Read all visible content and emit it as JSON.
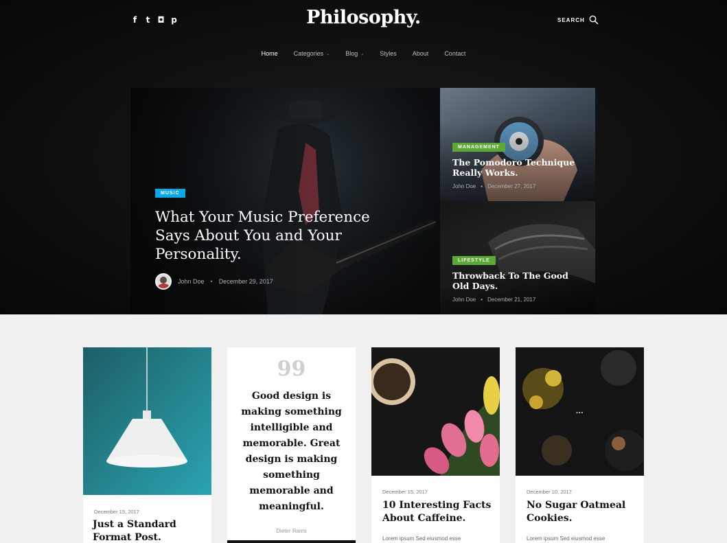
{
  "header": {
    "logo": "Philosophy.",
    "social": [
      {
        "icon": "facebook-icon",
        "glyph": "f"
      },
      {
        "icon": "twitter-icon",
        "glyph": "t"
      },
      {
        "icon": "instagram-icon",
        "glyph": "◘"
      },
      {
        "icon": "pinterest-icon",
        "glyph": "p"
      }
    ],
    "search_label": "SEARCH"
  },
  "nav": {
    "items": [
      {
        "label": "Home",
        "active": true,
        "dropdown": false
      },
      {
        "label": "Categories",
        "active": false,
        "dropdown": true
      },
      {
        "label": "Blog",
        "active": false,
        "dropdown": true
      },
      {
        "label": "Styles",
        "active": false,
        "dropdown": false
      },
      {
        "label": "About",
        "active": false,
        "dropdown": false
      },
      {
        "label": "Contact",
        "active": false,
        "dropdown": false
      }
    ]
  },
  "featured": {
    "main": {
      "category": "MUSIC",
      "title": "What Your Music Preference Says About You and Your Personality.",
      "author": "John Doe",
      "date": "December 29, 2017",
      "category_color": "#0aa7e6"
    },
    "side": [
      {
        "category": "MANAGEMENT",
        "title": "The Pomodoro Technique Really Works.",
        "author": "John Doe",
        "date": "December 27, 2017"
      },
      {
        "category": "LIFESTYLE",
        "title": "Throwback To The Good Old Days.",
        "author": "John Doe",
        "date": "December 21, 2017"
      }
    ],
    "side_category_color": "#5da935"
  },
  "cards": [
    {
      "type": "standard",
      "date": "December 15, 2017",
      "title": "Just a Standard Format Post."
    },
    {
      "type": "quote",
      "quote_mark": "99",
      "quote": "Good design is making something intelligible and memorable. Great design is making something memorable and meaningful.",
      "author": "Dieter Rams"
    },
    {
      "type": "standard",
      "date": "December 15, 2017",
      "title": "10 Interesting Facts About Caffeine.",
      "excerpt": "Lorem ipsum Sed eiusmod esse"
    },
    {
      "type": "standard",
      "date": "December 10, 2017",
      "title": "No Sugar Oatmeal Cookies.",
      "excerpt": "Lorem ipsum Sed eiusmod esse",
      "overlay_icon": "more-dots-icon",
      "overlay_text": "···"
    }
  ],
  "separator": "•"
}
